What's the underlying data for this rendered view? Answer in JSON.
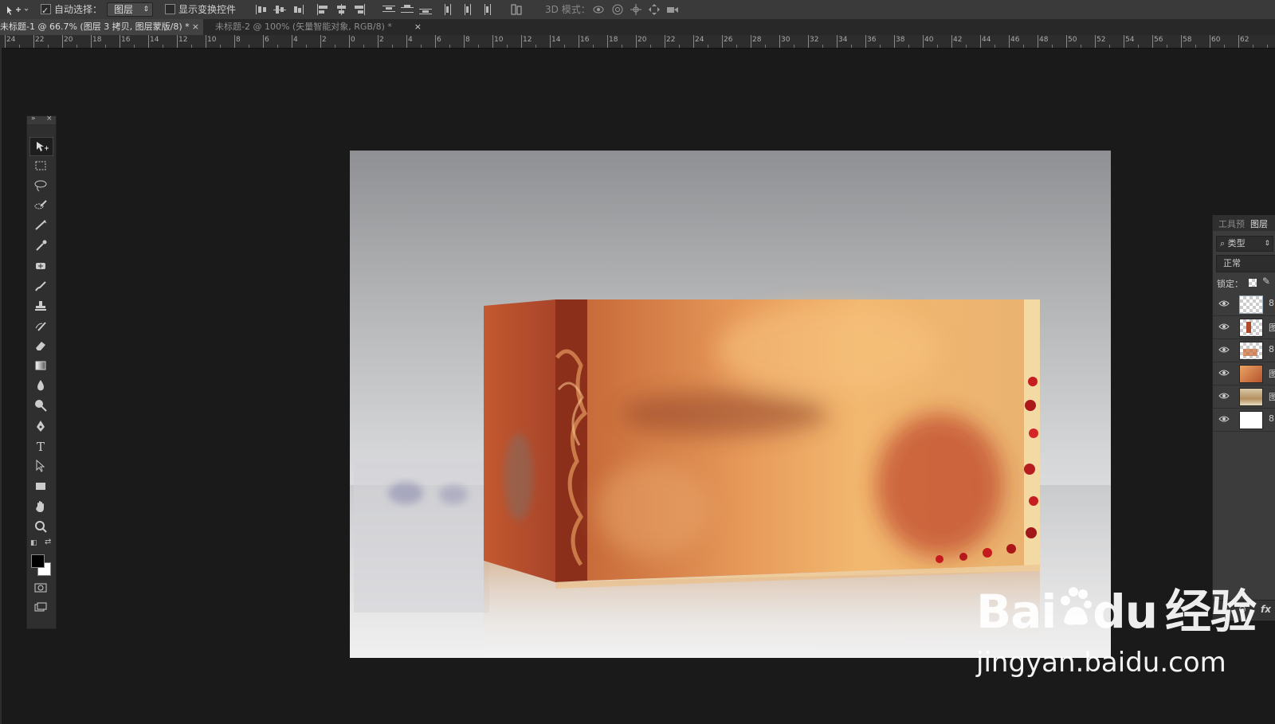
{
  "options_bar": {
    "auto_select_label": "自动选择：",
    "auto_select_checked": true,
    "auto_select_value": "图层",
    "show_transform_label": "显示变换控件",
    "show_transform_checked": false,
    "mode_3d_label": "3D 模式："
  },
  "tabs": [
    {
      "label": "未标题-1 @ 66.7% (图层 3 拷贝, 图层蒙版/8) *",
      "close": "×",
      "active": true
    },
    {
      "label": "未标题-2 @ 100% (矢量智能对象, RGB/8) *",
      "close": "×",
      "active": false
    }
  ],
  "ruler": {
    "labels": [
      "24",
      "22",
      "20",
      "18",
      "16",
      "14",
      "12",
      "10",
      "8",
      "6",
      "4",
      "2",
      "0",
      "2",
      "4",
      "6",
      "8",
      "10",
      "12",
      "14",
      "16",
      "18",
      "20",
      "22",
      "24",
      "26",
      "28",
      "30",
      "32",
      "34",
      "36",
      "38",
      "40",
      "42",
      "44",
      "46",
      "48",
      "50",
      "52",
      "54",
      "56",
      "58",
      "60",
      "62"
    ]
  },
  "toolbox": {
    "tools": [
      {
        "name": "move-tool",
        "icon": "move-icon",
        "active": true
      },
      {
        "name": "marquee-tool",
        "icon": "marquee-icon"
      },
      {
        "name": "lasso-tool",
        "icon": "lasso-icon"
      },
      {
        "name": "quick-selection-tool",
        "icon": "quick-selection-icon"
      },
      {
        "name": "crop-tool",
        "icon": "crop-icon"
      },
      {
        "name": "eyedropper-tool",
        "icon": "eyedropper-icon"
      },
      {
        "name": "healing-brush-tool",
        "icon": "healing-brush-icon"
      },
      {
        "name": "brush-tool",
        "icon": "brush-icon"
      },
      {
        "name": "clone-stamp-tool",
        "icon": "stamp-icon"
      },
      {
        "name": "history-brush-tool",
        "icon": "history-brush-icon"
      },
      {
        "name": "eraser-tool",
        "icon": "eraser-icon"
      },
      {
        "name": "gradient-tool",
        "icon": "gradient-icon"
      },
      {
        "name": "blur-tool",
        "icon": "blur-icon"
      },
      {
        "name": "dodge-tool",
        "icon": "dodge-icon"
      },
      {
        "name": "pen-tool",
        "icon": "pen-icon"
      },
      {
        "name": "type-tool",
        "icon": "type-icon",
        "glyph": "T"
      },
      {
        "name": "path-selection-tool",
        "icon": "path-selection-icon"
      },
      {
        "name": "rectangle-tool",
        "icon": "rectangle-icon"
      },
      {
        "name": "hand-tool",
        "icon": "hand-icon"
      },
      {
        "name": "zoom-tool",
        "icon": "zoom-icon"
      }
    ],
    "foreground_color": "#000000",
    "background_color": "#ffffff"
  },
  "layers_panel": {
    "tab_tool_presets": "工具预",
    "tab_layers": "图层",
    "filter_label": "类型",
    "blend_mode": "正常",
    "lock_label": "锁定：",
    "layers": [
      {
        "thumb": "checker",
        "mark": "8"
      },
      {
        "thumb": "checker-red",
        "mark": "图"
      },
      {
        "thumb": "checker-orange",
        "mark": "8"
      },
      {
        "thumb": "photo-orange",
        "mark": "图"
      },
      {
        "thumb": "photo-beige",
        "mark": "图"
      },
      {
        "thumb": "white",
        "mark": "8"
      }
    ],
    "footer_fx": "fx"
  },
  "watermark": {
    "brand": "Bai",
    "brand_tail": "du",
    "product": "经验",
    "url": "jingyan.baidu.com"
  },
  "colors": {
    "ui_dark": "#1a1a1a",
    "panel": "#3c3c3c",
    "box_orange": "#e8a860",
    "box_red": "#a0322a"
  }
}
